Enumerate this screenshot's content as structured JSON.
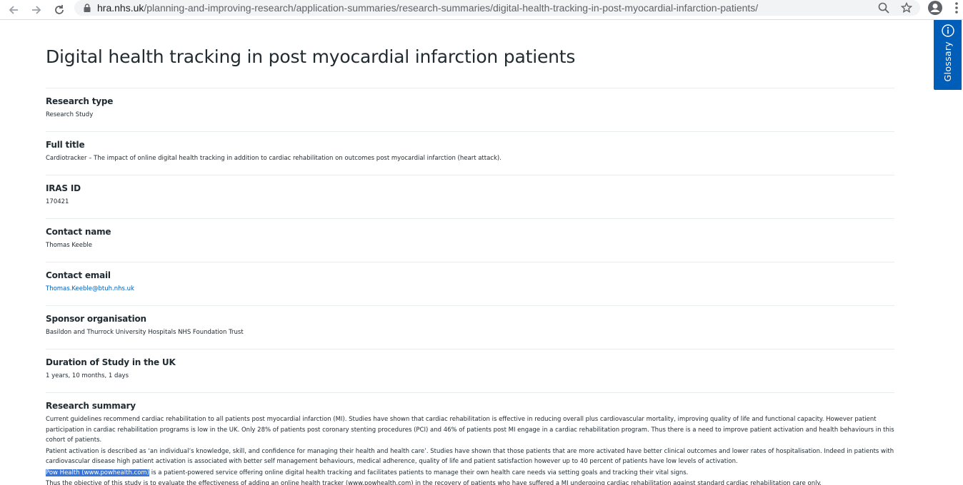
{
  "browser": {
    "url_host": "hra.nhs.uk",
    "url_path": "/planning-and-improving-research/application-summaries/research-summaries/digital-health-tracking-in-post-myocardial-infarction-patients/"
  },
  "page": {
    "title": "Digital health tracking in post myocardial infarction patients"
  },
  "fields": [
    {
      "label": "Research type",
      "value": "Research Study"
    },
    {
      "label": "Full title",
      "value": "Cardiotracker – The impact of online digital health tracking in addition to cardiac rehabilitation on outcomes post myocardial infarction (heart attack)."
    },
    {
      "label": "IRAS ID",
      "value": "170421"
    },
    {
      "label": "Contact name",
      "value": "Thomas Keeble"
    },
    {
      "label": "Contact email",
      "value": "Thomas.Keeble@btuh.nhs.uk"
    },
    {
      "label": "Sponsor organisation",
      "value": "Basildon and Thurrock University Hospitals NHS Foundation Trust"
    },
    {
      "label": "Duration of Study in the UK",
      "value": "1 years, 10 months, 1 days"
    }
  ],
  "summary": {
    "label": "Research summary",
    "para1": "Current guidelines recommend cardiac rehabilitation to all patients post myocardial infarction (MI). Studies have shown that cardiac rehabilitation is effective in reducing overall plus cardiovascular mortality, improving quality of life and functional capacity. However patient participation in cardiac rehabilitation programs is low in the UK. Only 28% of patients post coronary stenting procedures (PCI) and 46% of patients post MI engage in a cardiac rehabilitation program. Thus there is a need to improve patient activation and health behaviours in this cohort of patients.",
    "para2": "Patient activation is described as ‘an individual’s knowledge, skill, and confidence for managing their health and health care’. Studies have shown that those patients that are more activated have better clinical outcomes and lower rates of hospitalisation. Indeed in patients with cardiovascular disease high patient activation is associated with better self management behaviours, medical adherence, quality of life and patient satisfaction however up to 40 percent of patients have low levels of activation.",
    "para3_highlight": "Pow Health (www.powhealth.com)",
    "para3_rest": " is a patient-powered service offering online digital health tracking and facilitates patients to manage their own health care needs via setting goals and tracking their vital signs.",
    "para4": "Thus the objective of this study is to evaluate the effectiveness of adding an online health tracker (www.powhealth.com) in the recovery of patients who have suffered a MI undergoing cardiac rehabilitation against standard cardiac rehabilitation care only."
  },
  "glossary": {
    "label": "Glossary"
  },
  "colors": {
    "link": "#005eb8",
    "glossary_bg": "#005eb8",
    "highlight": "#3875d7"
  },
  "icons": [
    "back-arrow-icon",
    "forward-arrow-icon",
    "reload-icon",
    "lock-icon",
    "zoom-icon",
    "star-icon",
    "profile-icon",
    "menu-icon",
    "info-icon"
  ]
}
